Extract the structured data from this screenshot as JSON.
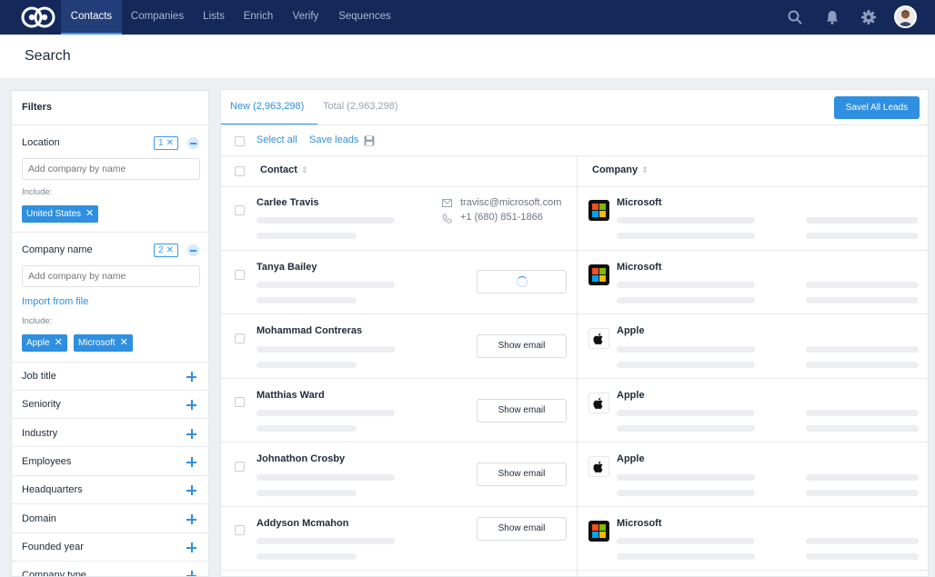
{
  "nav": {
    "items": [
      "Contacts",
      "Companies",
      "Lists",
      "Enrich",
      "Verify",
      "Sequences"
    ],
    "active": "Contacts",
    "icons": [
      "search-icon",
      "bell-icon",
      "gear-icon",
      "avatar"
    ]
  },
  "page": {
    "title": "Search"
  },
  "filters": {
    "title": "Filters",
    "location": {
      "label": "Location",
      "count": "1",
      "placeholder": "Add company by name",
      "include_label": "Include:",
      "chips": [
        "United States"
      ]
    },
    "company_name": {
      "label": "Company name",
      "count": "2",
      "placeholder": "Add company by name",
      "import_label": "Import from file",
      "include_label": "Include:",
      "chips": [
        "Apple",
        "Microsoft"
      ]
    },
    "collapsed": [
      "Job title",
      "Seniority",
      "Industry",
      "Employees",
      "Headquarters",
      "Domain",
      "Founded year",
      "Company type"
    ]
  },
  "results": {
    "tabs": [
      "New (2,963,298)",
      "Total (2,963,298)"
    ],
    "save_all_label": "Savel All Leads",
    "select_all_label": "Select all",
    "save_leads_label": "Save leads",
    "columns": [
      "Contact",
      "Company"
    ],
    "show_email_label": "Show email",
    "rows": [
      {
        "name": "Carlee Travis",
        "email": "travisc@microsoft.com",
        "phone": "+1 (680) 851-1866",
        "company": "Microsoft",
        "logo": "microsoft-logo"
      },
      {
        "name": "Tanya Bailey",
        "state": "loading",
        "company": "Microsoft",
        "logo": "microsoft-logo"
      },
      {
        "name": "Mohammad Contreras",
        "company": "Apple",
        "logo": "apple-logo"
      },
      {
        "name": "Matthias Ward",
        "company": "Apple",
        "logo": "apple-logo"
      },
      {
        "name": "Johnathon Crosby",
        "company": "Apple",
        "logo": "apple-logo"
      },
      {
        "name": "Addyson Mcmahon",
        "company": "Microsoft",
        "logo": "microsoft-logo"
      }
    ]
  },
  "colors": {
    "nav_bg": "#14295a",
    "accent": "#2f8fe0",
    "page_bg": "#edf0f3"
  }
}
